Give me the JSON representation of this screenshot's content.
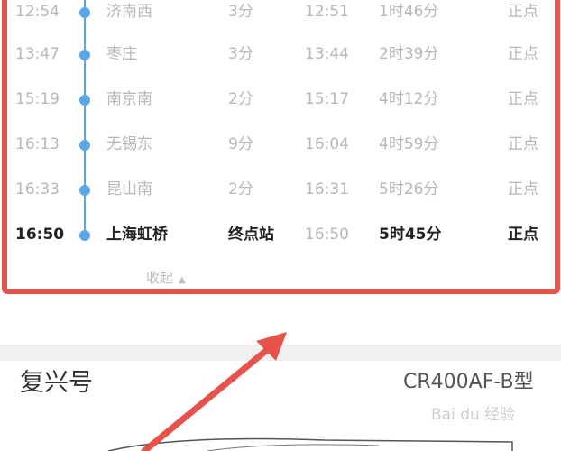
{
  "stations": [
    {
      "arrival": "12:54",
      "name": "济南西",
      "stop": "3分",
      "depart": "12:51",
      "elapsed": "1时46分",
      "status": "正点"
    },
    {
      "arrival": "13:47",
      "name": "枣庄",
      "stop": "3分",
      "depart": "13:44",
      "elapsed": "2时39分",
      "status": "正点"
    },
    {
      "arrival": "15:19",
      "name": "南京南",
      "stop": "2分",
      "depart": "15:17",
      "elapsed": "4时12分",
      "status": "正点"
    },
    {
      "arrival": "16:13",
      "name": "无锡东",
      "stop": "9分",
      "depart": "16:04",
      "elapsed": "4时59分",
      "status": "正点"
    },
    {
      "arrival": "16:33",
      "name": "昆山南",
      "stop": "2分",
      "depart": "16:31",
      "elapsed": "5时26分",
      "status": "正点"
    },
    {
      "arrival": "16:50",
      "name": "上海虹桥",
      "stop": "终点站",
      "depart": "16:50",
      "elapsed": "5时45分",
      "status": "正点"
    }
  ],
  "collapse_label": "收起",
  "train": {
    "name": "复兴号",
    "model": "CR400AF-B型"
  },
  "watermark": "Bai du 经验",
  "colors": {
    "highlight_border": "#e5534b",
    "timeline": "#5aa6e8"
  }
}
